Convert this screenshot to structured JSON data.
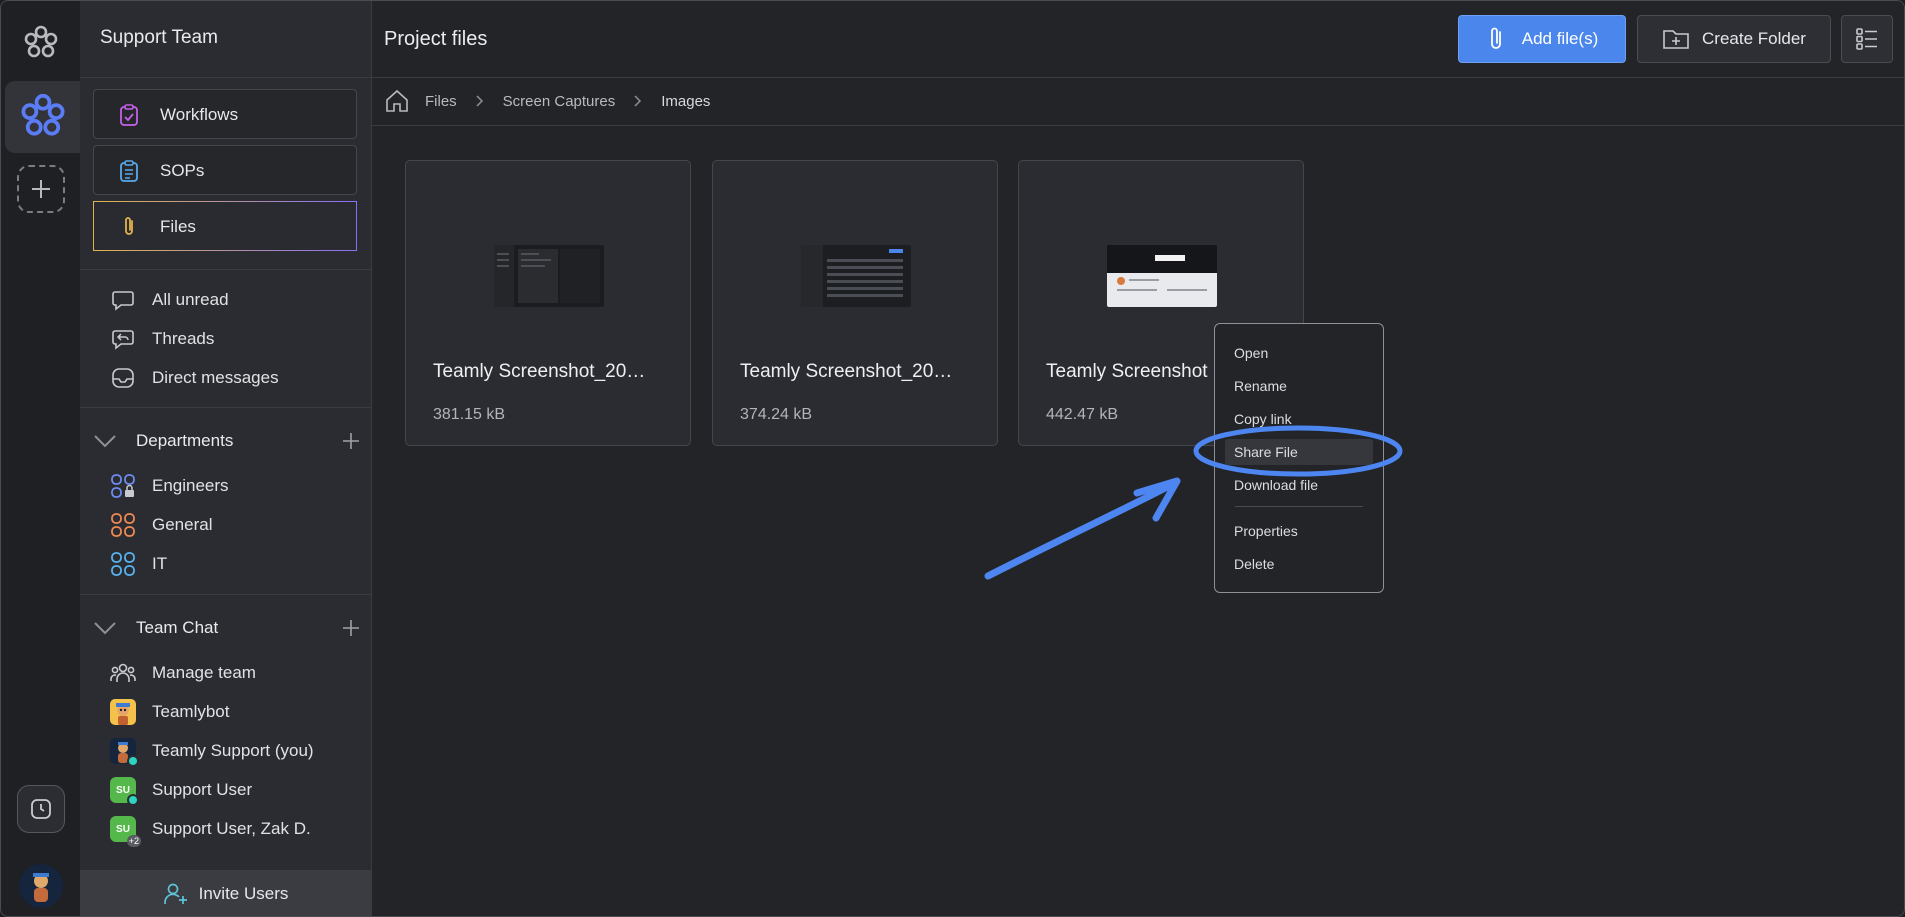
{
  "sidebar": {
    "team_name": "Support Team",
    "nav": [
      {
        "label": "Workflows",
        "icon": "clipboard-check-icon"
      },
      {
        "label": "SOPs",
        "icon": "clipboard-list-icon"
      },
      {
        "label": "Files",
        "icon": "paperclip-icon",
        "active": true
      }
    ],
    "inbox": [
      {
        "label": "All unread",
        "icon": "chat-bubble-icon"
      },
      {
        "label": "Threads",
        "icon": "reply-bubble-icon"
      },
      {
        "label": "Direct messages",
        "icon": "inbox-icon"
      }
    ],
    "departments_label": "Departments",
    "departments": [
      {
        "label": "Engineers",
        "color": "#6d8df0"
      },
      {
        "label": "General",
        "color": "#f08a54"
      },
      {
        "label": "IT",
        "color": "#58b4f0"
      }
    ],
    "team_chat_label": "Team Chat",
    "team_chat": [
      {
        "label": "Manage team"
      },
      {
        "label": "Teamlybot"
      },
      {
        "label": "Teamly Support (you)"
      },
      {
        "label": "Support User",
        "avatar_text": "SU",
        "avatar_color": "#55b84a"
      },
      {
        "label": "Support User, Zak D.",
        "avatar_text": "SU",
        "avatar_color": "#55b84a",
        "badge": "+2"
      }
    ],
    "invite_label": "Invite Users"
  },
  "header": {
    "title": "Project files",
    "add_label": "Add file(s)",
    "folder_label": "Create Folder"
  },
  "breadcrumb": [
    "Files",
    "Screen Captures",
    "Images"
  ],
  "files": [
    {
      "name": "Teamly Screenshot_20…",
      "size": "381.15 kB"
    },
    {
      "name": "Teamly Screenshot_20…",
      "size": "374.24 kB"
    },
    {
      "name": "Teamly Screenshot",
      "size": "442.47 kB"
    }
  ],
  "context_menu": {
    "items": [
      "Open",
      "Rename",
      "Copy link",
      "Share File",
      "Download file"
    ],
    "items2": [
      "Properties",
      "Delete"
    ],
    "highlighted": "Share File"
  },
  "colors": {
    "accent": "#4a86ec",
    "annotation": "#4d86f0"
  }
}
